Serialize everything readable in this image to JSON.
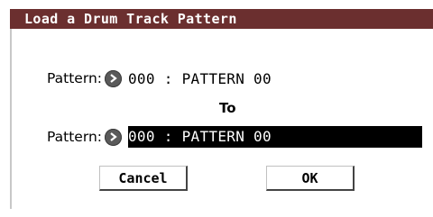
{
  "dialog": {
    "title": "Load a Drum Track Pattern",
    "title_bar_color": "#6b2f2f"
  },
  "source": {
    "label": "Pattern:",
    "value": "000 : PATTERN 00"
  },
  "to_label": "To",
  "destination": {
    "label": "Pattern:",
    "value": "000 : PATTERN 00"
  },
  "buttons": {
    "cancel": "Cancel",
    "ok": "OK"
  }
}
